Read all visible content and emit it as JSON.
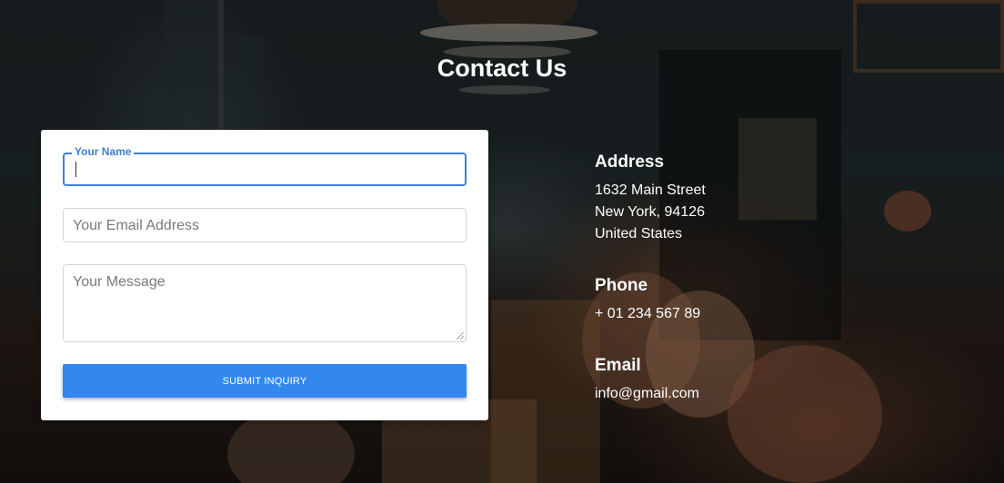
{
  "page": {
    "title": "Contact Us"
  },
  "form": {
    "name_label": "Your Name",
    "name_value": "",
    "email_placeholder": "Your Email Address",
    "message_placeholder": "Your Message",
    "submit_label": "SUBMIT INQUIRY"
  },
  "info": {
    "address": {
      "heading": "Address",
      "lines": [
        "1632 Main Street",
        "New York, 94126",
        "United States"
      ]
    },
    "phone": {
      "heading": "Phone",
      "value": "+ 01 234 567 89"
    },
    "email": {
      "heading": "Email",
      "value": "info@gmail.com"
    }
  },
  "colors": {
    "accent": "#3388ee",
    "focus": "#3a80d0",
    "text_light": "#ffffff"
  }
}
